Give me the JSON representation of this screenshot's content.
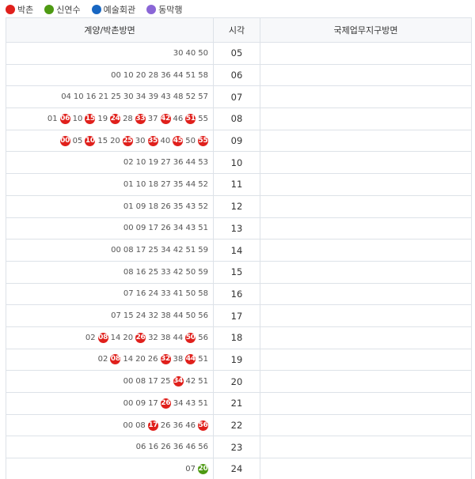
{
  "legend": [
    {
      "label": "박촌",
      "color": "#e0201c"
    },
    {
      "label": "신연수",
      "color": "#4e9a13"
    },
    {
      "label": "예술회관",
      "color": "#1766c2"
    },
    {
      "label": "동막행",
      "color": "#8a66d6"
    }
  ],
  "headers": {
    "left": "계양/박촌방면",
    "mid": "시각",
    "right": "국제업무지구방면"
  },
  "colors": {
    "red": "#e0201c",
    "green": "#4e9a13",
    "header_bg": "#f7f8fa",
    "border": "#dde2e8"
  },
  "rows": [
    {
      "hour": "05",
      "minutes": [
        {
          "t": "30"
        },
        {
          "t": "40"
        },
        {
          "t": "50"
        }
      ]
    },
    {
      "hour": "06",
      "minutes": [
        {
          "t": "00"
        },
        {
          "t": "10"
        },
        {
          "t": "20"
        },
        {
          "t": "28"
        },
        {
          "t": "36"
        },
        {
          "t": "44"
        },
        {
          "t": "51"
        },
        {
          "t": "58"
        }
      ]
    },
    {
      "hour": "07",
      "minutes": [
        {
          "t": "04"
        },
        {
          "t": "10"
        },
        {
          "t": "16"
        },
        {
          "t": "21"
        },
        {
          "t": "25"
        },
        {
          "t": "30"
        },
        {
          "t": "34"
        },
        {
          "t": "39"
        },
        {
          "t": "43"
        },
        {
          "t": "48"
        },
        {
          "t": "52"
        },
        {
          "t": "57"
        }
      ]
    },
    {
      "hour": "08",
      "minutes": [
        {
          "t": "01"
        },
        {
          "t": "06",
          "c": "red"
        },
        {
          "t": "10"
        },
        {
          "t": "15",
          "c": "red"
        },
        {
          "t": "19"
        },
        {
          "t": "24",
          "c": "red"
        },
        {
          "t": "28"
        },
        {
          "t": "33",
          "c": "red"
        },
        {
          "t": "37"
        },
        {
          "t": "42",
          "c": "red"
        },
        {
          "t": "46"
        },
        {
          "t": "51",
          "c": "red"
        },
        {
          "t": "55"
        }
      ]
    },
    {
      "hour": "09",
      "minutes": [
        {
          "t": "00",
          "c": "red"
        },
        {
          "t": "05"
        },
        {
          "t": "10",
          "c": "red"
        },
        {
          "t": "15"
        },
        {
          "t": "20"
        },
        {
          "t": "25",
          "c": "red"
        },
        {
          "t": "30"
        },
        {
          "t": "35",
          "c": "red"
        },
        {
          "t": "40"
        },
        {
          "t": "45",
          "c": "red"
        },
        {
          "t": "50"
        },
        {
          "t": "55",
          "c": "red"
        }
      ]
    },
    {
      "hour": "10",
      "minutes": [
        {
          "t": "02"
        },
        {
          "t": "10"
        },
        {
          "t": "19"
        },
        {
          "t": "27"
        },
        {
          "t": "36"
        },
        {
          "t": "44"
        },
        {
          "t": "53"
        }
      ]
    },
    {
      "hour": "11",
      "minutes": [
        {
          "t": "01"
        },
        {
          "t": "10"
        },
        {
          "t": "18"
        },
        {
          "t": "27"
        },
        {
          "t": "35"
        },
        {
          "t": "44"
        },
        {
          "t": "52"
        }
      ]
    },
    {
      "hour": "12",
      "minutes": [
        {
          "t": "01"
        },
        {
          "t": "09"
        },
        {
          "t": "18"
        },
        {
          "t": "26"
        },
        {
          "t": "35"
        },
        {
          "t": "43"
        },
        {
          "t": "52"
        }
      ]
    },
    {
      "hour": "13",
      "minutes": [
        {
          "t": "00"
        },
        {
          "t": "09"
        },
        {
          "t": "17"
        },
        {
          "t": "26"
        },
        {
          "t": "34"
        },
        {
          "t": "43"
        },
        {
          "t": "51"
        }
      ]
    },
    {
      "hour": "14",
      "minutes": [
        {
          "t": "00"
        },
        {
          "t": "08"
        },
        {
          "t": "17"
        },
        {
          "t": "25"
        },
        {
          "t": "34"
        },
        {
          "t": "42"
        },
        {
          "t": "51"
        },
        {
          "t": "59"
        }
      ]
    },
    {
      "hour": "15",
      "minutes": [
        {
          "t": "08"
        },
        {
          "t": "16"
        },
        {
          "t": "25"
        },
        {
          "t": "33"
        },
        {
          "t": "42"
        },
        {
          "t": "50"
        },
        {
          "t": "59"
        }
      ]
    },
    {
      "hour": "16",
      "minutes": [
        {
          "t": "07"
        },
        {
          "t": "16"
        },
        {
          "t": "24"
        },
        {
          "t": "33"
        },
        {
          "t": "41"
        },
        {
          "t": "50"
        },
        {
          "t": "58"
        }
      ]
    },
    {
      "hour": "17",
      "minutes": [
        {
          "t": "07"
        },
        {
          "t": "15"
        },
        {
          "t": "24"
        },
        {
          "t": "32"
        },
        {
          "t": "38"
        },
        {
          "t": "44"
        },
        {
          "t": "50"
        },
        {
          "t": "56"
        }
      ]
    },
    {
      "hour": "18",
      "minutes": [
        {
          "t": "02"
        },
        {
          "t": "08",
          "c": "red"
        },
        {
          "t": "14"
        },
        {
          "t": "20"
        },
        {
          "t": "26",
          "c": "red"
        },
        {
          "t": "32"
        },
        {
          "t": "38"
        },
        {
          "t": "44"
        },
        {
          "t": "50",
          "c": "red"
        },
        {
          "t": "56"
        }
      ]
    },
    {
      "hour": "19",
      "minutes": [
        {
          "t": "02"
        },
        {
          "t": "08",
          "c": "red"
        },
        {
          "t": "14"
        },
        {
          "t": "20"
        },
        {
          "t": "26"
        },
        {
          "t": "32",
          "c": "red"
        },
        {
          "t": "38"
        },
        {
          "t": "44",
          "c": "red"
        },
        {
          "t": "51"
        }
      ]
    },
    {
      "hour": "20",
      "minutes": [
        {
          "t": "00"
        },
        {
          "t": "08"
        },
        {
          "t": "17"
        },
        {
          "t": "25"
        },
        {
          "t": "34",
          "c": "red"
        },
        {
          "t": "42"
        },
        {
          "t": "51"
        }
      ]
    },
    {
      "hour": "21",
      "minutes": [
        {
          "t": "00"
        },
        {
          "t": "09"
        },
        {
          "t": "17"
        },
        {
          "t": "26",
          "c": "red"
        },
        {
          "t": "34"
        },
        {
          "t": "43"
        },
        {
          "t": "51"
        }
      ]
    },
    {
      "hour": "22",
      "minutes": [
        {
          "t": "00"
        },
        {
          "t": "08"
        },
        {
          "t": "17",
          "c": "red"
        },
        {
          "t": "26"
        },
        {
          "t": "36"
        },
        {
          "t": "46"
        },
        {
          "t": "56",
          "c": "red"
        }
      ]
    },
    {
      "hour": "23",
      "minutes": [
        {
          "t": "06"
        },
        {
          "t": "16"
        },
        {
          "t": "26"
        },
        {
          "t": "36"
        },
        {
          "t": "46"
        },
        {
          "t": "56"
        }
      ]
    },
    {
      "hour": "24",
      "minutes": [
        {
          "t": "07"
        },
        {
          "t": "20",
          "c": "green"
        }
      ]
    }
  ]
}
